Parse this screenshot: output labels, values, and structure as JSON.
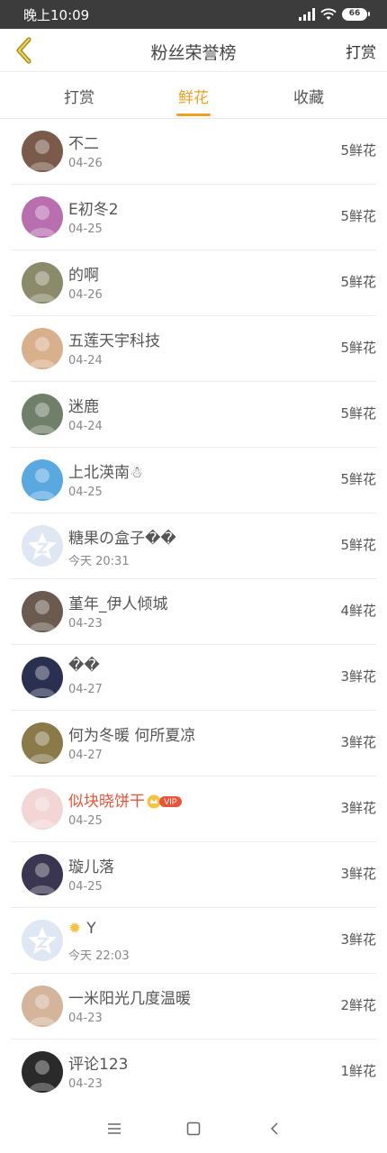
{
  "status_bar": {
    "time": "晚上10:09",
    "battery": "66"
  },
  "header": {
    "title": "粉丝荣誉榜",
    "action_label": "打赏"
  },
  "tabs": [
    {
      "label": "打赏"
    },
    {
      "label": "鲜花"
    },
    {
      "label": "收藏"
    }
  ],
  "active_tab": "鲜花",
  "accent_color": "#f0a020",
  "list": [
    {
      "name": "不二",
      "date": "04-26",
      "amount": "5鲜花",
      "avatar_color": "#7a5a4a"
    },
    {
      "name": "E初冬2",
      "date": "04-25",
      "amount": "5鲜花",
      "avatar_color": "#b86fb0"
    },
    {
      "name": "的啊",
      "date": "04-26",
      "amount": "5鲜花",
      "avatar_color": "#8b8a6a"
    },
    {
      "name": "五莲天宇科技",
      "date": "04-24",
      "amount": "5鲜花",
      "avatar_color": "#d9b08c"
    },
    {
      "name": "迷鹿",
      "date": "04-24",
      "amount": "5鲜花",
      "avatar_color": "#6f7f6a"
    },
    {
      "name": "上北渶南☃",
      "date": "04-25",
      "amount": "5鲜花",
      "avatar_color": "#59a8e0"
    },
    {
      "name": "糖果の盒子��",
      "date": "今天 20:31",
      "amount": "5鲜花",
      "avatar_color": "#dfe8f2"
    },
    {
      "name": "堇年_伊人倾城",
      "date": "04-23",
      "amount": "4鲜花",
      "avatar_color": "#6a5a50"
    },
    {
      "name": "��",
      "date": "04-27",
      "amount": "3鲜花",
      "avatar_color": "#2a3050"
    },
    {
      "name": "何为冬暖 何所夏凉",
      "date": "04-27",
      "amount": "3鲜花",
      "avatar_color": "#8a7a4a"
    },
    {
      "name": "似块晓饼干",
      "date": "04-25",
      "amount": "3鲜花",
      "avatar_color": "#f2d6d6",
      "vip": true
    },
    {
      "name": "璇儿落",
      "date": "04-25",
      "amount": "3鲜花",
      "avatar_color": "#3a3550"
    },
    {
      "name": "Y",
      "date": "今天 22:03",
      "amount": "3鲜花",
      "avatar_color": "#dfe8f2"
    },
    {
      "name": "一米阳光几度温暖",
      "date": "04-23",
      "amount": "2鲜花",
      "avatar_color": "#d4b49a"
    },
    {
      "name": "评论123",
      "date": "04-23",
      "amount": "1鲜花",
      "avatar_color": "#2a2a2a"
    }
  ],
  "vip_label": "VIP"
}
